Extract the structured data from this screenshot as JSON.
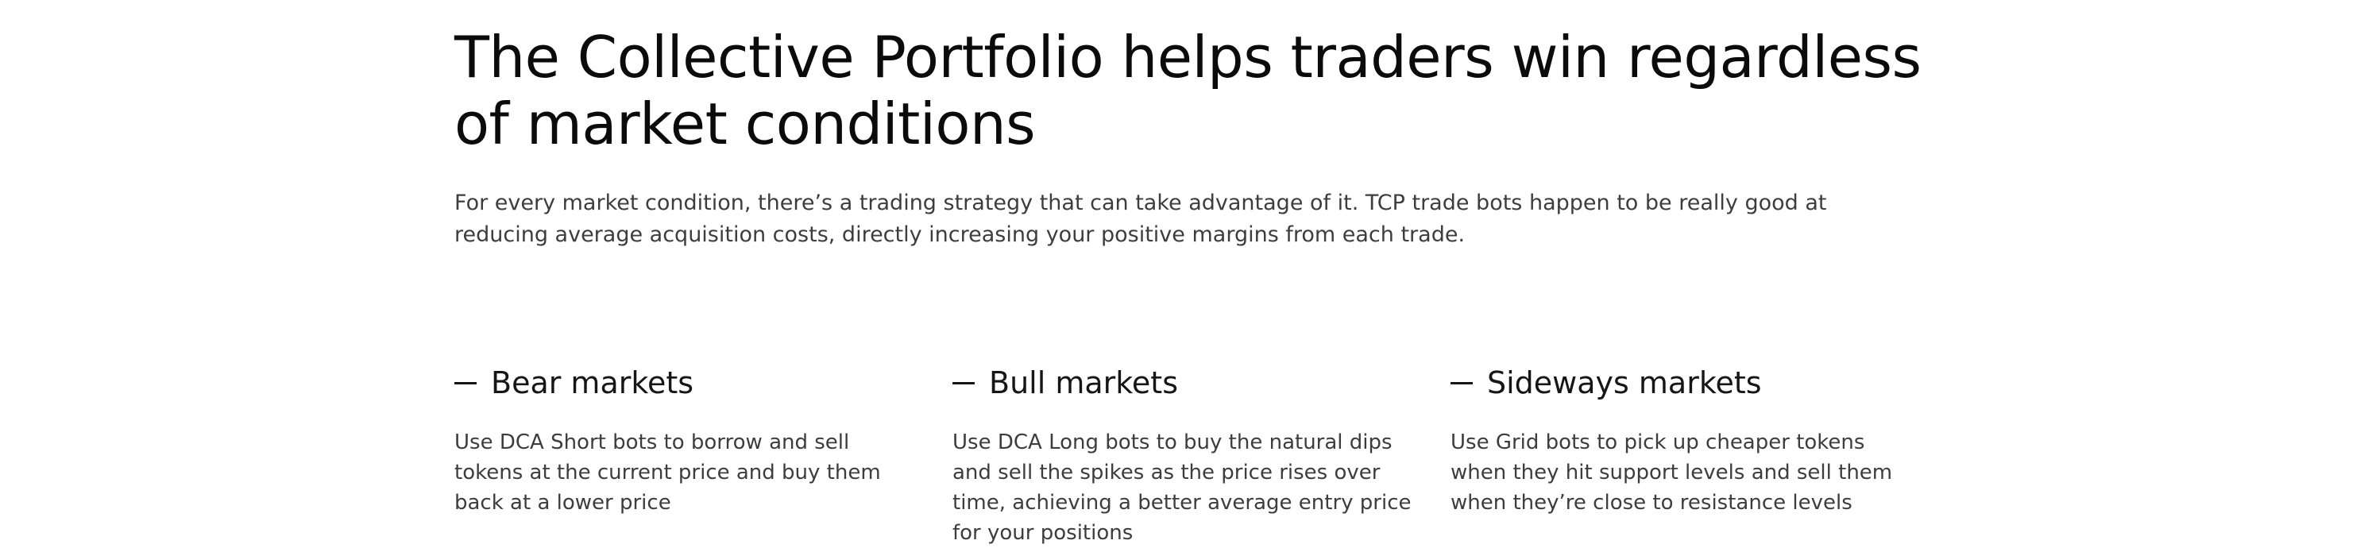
{
  "hero": {
    "heading": "The Collective Portfolio helps traders win regardless of market conditions",
    "intro": "For every market condition, there’s a trading strategy that can take advantage of it. TCP trade bots happen to be really good at reducing average acquisition costs, directly increasing your positive margins from each trade."
  },
  "markets": [
    {
      "title": "Bear markets",
      "text": "Use DCA Short bots to borrow and sell tokens at the current price and buy them back at a lower price"
    },
    {
      "title": "Bull markets",
      "text": "Use DCA Long bots to buy the natural dips and sell the spikes as the price rises over time, achieving a better average entry price for your positions"
    },
    {
      "title": "Sideways markets",
      "text": "Use Grid bots to pick up cheaper tokens when they hit support levels and sell them when they’re close to resistance levels"
    }
  ]
}
